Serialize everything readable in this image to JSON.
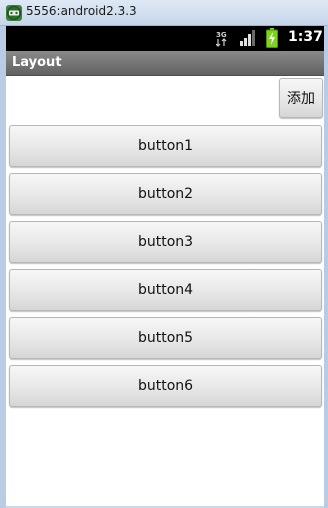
{
  "window": {
    "title": "5556:android2.3.3"
  },
  "statusbar": {
    "network": "3G",
    "time": "1:37"
  },
  "app": {
    "title": "Layout"
  },
  "add_button": {
    "label": "添加"
  },
  "buttons": [
    {
      "label": "button1"
    },
    {
      "label": "button2"
    },
    {
      "label": "button3"
    },
    {
      "label": "button4"
    },
    {
      "label": "button5"
    },
    {
      "label": "button6"
    }
  ],
  "colors": {
    "window_chrome": "#c6d6ea",
    "statusbar": "#000000",
    "appbar": "#6e6e6e",
    "battery": "#7ed321"
  },
  "icons": [
    "emulator-icon",
    "3g-icon",
    "signal-icon",
    "battery-charging-icon"
  ]
}
